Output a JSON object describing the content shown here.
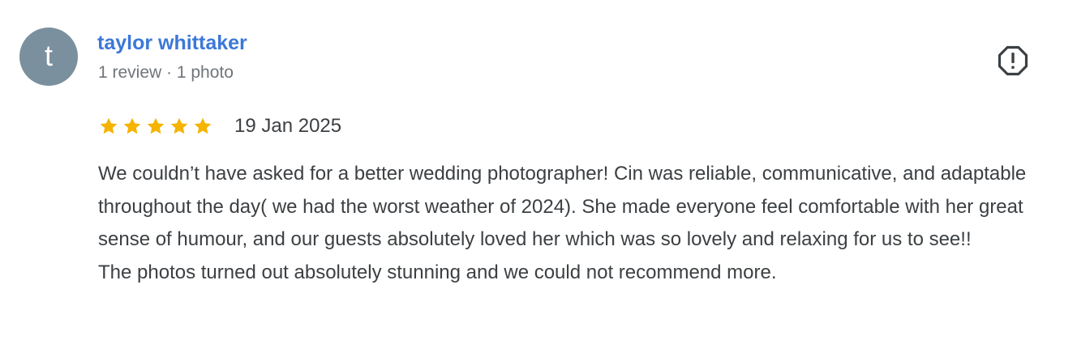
{
  "review": {
    "avatar_letter": "t",
    "author_name": "taylor whittaker",
    "author_meta": "1 review · 1 photo",
    "rating": 5,
    "rating_max": 5,
    "date": "19 Jan 2025",
    "text_paragraphs": [
      "We couldn’t have asked for a better wedding photographer! Cin was reliable, communicative, and adaptable throughout the day( we had the worst weather of 2024). She made everyone feel comfortable with her great sense of humour, and our guests absolutely loved her which was so lovely and relaxing for us to see!!",
      "The photos turned out absolutely stunning and we could not recommend more."
    ],
    "report_icon": "report-flag-octagon-icon"
  },
  "colors": {
    "avatar_bg": "#7b909e",
    "author_link": "#3c78d8",
    "star_filled": "#f4b400",
    "meta_text": "#70757a",
    "body_text": "#3c4043"
  }
}
